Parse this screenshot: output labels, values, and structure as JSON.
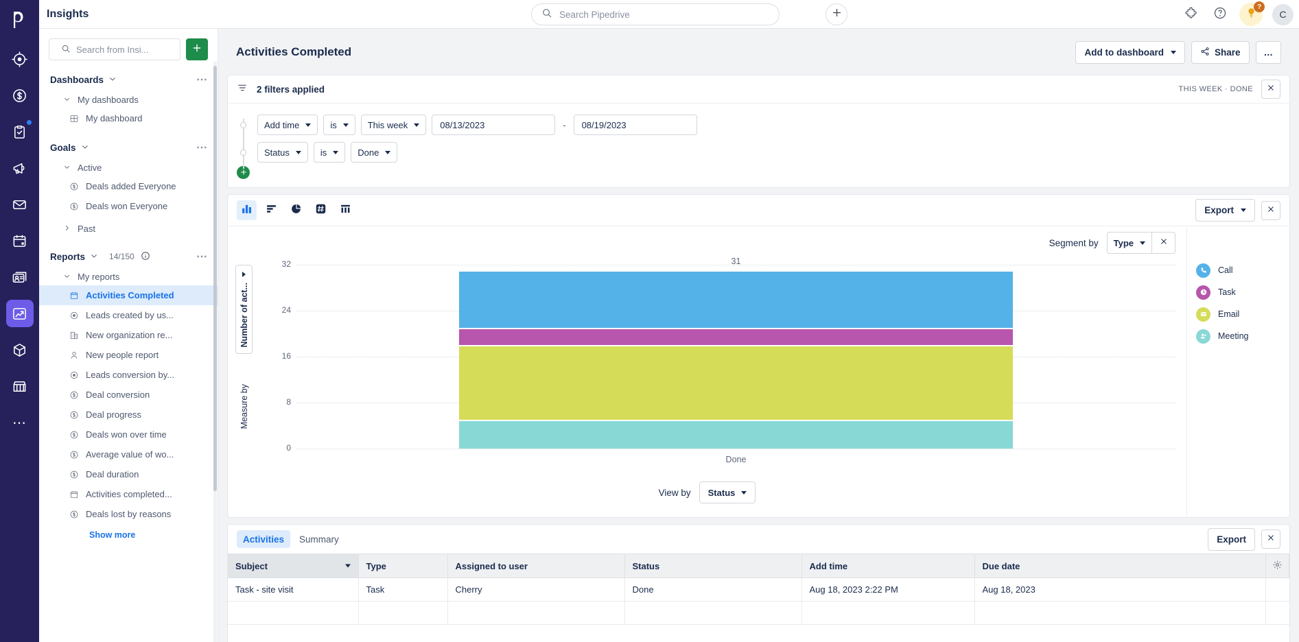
{
  "rail": {
    "logo": "pipedrive-logo",
    "items": [
      {
        "name": "leads-icon",
        "active": false,
        "dot": false
      },
      {
        "name": "deals-icon",
        "active": false,
        "dot": false
      },
      {
        "name": "activities-icon",
        "active": false,
        "dot": true
      },
      {
        "name": "campaigns-icon",
        "active": false,
        "dot": false
      },
      {
        "name": "mail-icon",
        "active": false,
        "dot": false
      },
      {
        "name": "calendar-icon",
        "active": false,
        "dot": false
      },
      {
        "name": "contacts-icon",
        "active": false,
        "dot": false
      },
      {
        "name": "insights-icon",
        "active": true,
        "dot": false
      },
      {
        "name": "products-icon",
        "active": false,
        "dot": false
      },
      {
        "name": "marketplace-icon",
        "active": false,
        "dot": false
      },
      {
        "name": "more-icon",
        "active": false,
        "dot": false
      }
    ]
  },
  "topbar": {
    "title": "Insights",
    "search_placeholder": "Search Pipedrive",
    "add_label": "+",
    "bulb_badge": "?",
    "avatar_initial": "C"
  },
  "sidebar": {
    "search_placeholder": "Search from Insi...",
    "add_label": "+",
    "groups": [
      {
        "title": "Dashboards",
        "sub": "My dashboards",
        "items": [
          {
            "label": "My dashboard",
            "icon": "dashboard-icon",
            "selected": false
          }
        ]
      },
      {
        "title": "Goals",
        "sub": "Active",
        "items": [
          {
            "label": "Deals added Everyone",
            "icon": "deal-icon",
            "selected": false
          },
          {
            "label": "Deals won Everyone",
            "icon": "deal-icon",
            "selected": false
          }
        ],
        "past": "Past"
      },
      {
        "title": "Reports",
        "count": "14/150",
        "sub": "My reports",
        "items": [
          {
            "label": "Activities Completed",
            "icon": "calendar-icon",
            "selected": true
          },
          {
            "label": "Leads created by us...",
            "icon": "leads-icon",
            "selected": false
          },
          {
            "label": "New organization re...",
            "icon": "organization-icon",
            "selected": false
          },
          {
            "label": "New people report",
            "icon": "person-icon",
            "selected": false
          },
          {
            "label": "Leads conversion by...",
            "icon": "leads-icon",
            "selected": false
          },
          {
            "label": "Deal conversion",
            "icon": "deal-icon",
            "selected": false
          },
          {
            "label": "Deal progress",
            "icon": "deal-icon",
            "selected": false
          },
          {
            "label": "Deals won over time",
            "icon": "deal-icon",
            "selected": false
          },
          {
            "label": "Average value of wo...",
            "icon": "deal-icon",
            "selected": false
          },
          {
            "label": "Deal duration",
            "icon": "deal-icon",
            "selected": false
          },
          {
            "label": "Activities completed...",
            "icon": "calendar-icon",
            "selected": false
          },
          {
            "label": "Deals lost by reasons",
            "icon": "deal-icon",
            "selected": false
          }
        ],
        "show_more": "Show more"
      }
    ]
  },
  "report": {
    "title": "Activities Completed",
    "add_to_dashboard": "Add to dashboard",
    "share": "Share",
    "more": "…"
  },
  "filters": {
    "summary": "2 filters applied",
    "tags": "THIS WEEK  ·  DONE",
    "rows": [
      {
        "field": "Add time",
        "operator": "is",
        "value": "This week",
        "date_from": "08/13/2023",
        "date_to": "08/19/2023",
        "separator": "-"
      },
      {
        "field": "Status",
        "operator": "is",
        "value": "Done"
      }
    ]
  },
  "chart_toolbar": {
    "types": [
      {
        "name": "bar-chart-icon",
        "active": true
      },
      {
        "name": "horizontal-bar-chart-icon",
        "active": false
      },
      {
        "name": "pie-chart-icon",
        "active": false
      },
      {
        "name": "scorecard-icon",
        "active": false
      },
      {
        "name": "table-icon",
        "active": false
      }
    ],
    "export": "Export"
  },
  "chart_controls": {
    "segment_by_label": "Segment by",
    "segment_by_value": "Type",
    "view_by_label": "View by",
    "view_by_value": "Status",
    "measure_by_label": "Measure by",
    "y_axis_label": "Number of act..."
  },
  "chart_data": {
    "type": "bar",
    "stacked": true,
    "title": "Activities Completed",
    "xlabel": "",
    "ylabel": "Number of act...",
    "categories": [
      "Done"
    ],
    "ylim": [
      0,
      32
    ],
    "yticks": [
      0,
      8,
      16,
      24,
      32
    ],
    "grid": true,
    "legend_position": "right",
    "data_labels": [
      "31"
    ],
    "totals": [
      31
    ],
    "series": [
      {
        "name": "Call",
        "values": [
          10
        ],
        "color": "#55b2e8"
      },
      {
        "name": "Task",
        "values": [
          3
        ],
        "color": "#b855ac"
      },
      {
        "name": "Email",
        "values": [
          13
        ],
        "color": "#d5dc58"
      },
      {
        "name": "Meeting",
        "values": [
          5
        ],
        "color": "#88d8d6"
      }
    ]
  },
  "legend": [
    {
      "label": "Call",
      "color": "#55b2e8",
      "icon": "phone-icon"
    },
    {
      "label": "Task",
      "color": "#b855ac",
      "icon": "clock-icon"
    },
    {
      "label": "Email",
      "color": "#d5dc58",
      "icon": "envelope-icon"
    },
    {
      "label": "Meeting",
      "color": "#88d8d6",
      "icon": "people-icon"
    }
  ],
  "table": {
    "tabs": [
      {
        "label": "Activities",
        "active": true
      },
      {
        "label": "Summary",
        "active": false
      }
    ],
    "export": "Export",
    "columns": [
      "Subject",
      "Type",
      "Assigned to user",
      "Status",
      "Add time",
      "Due date"
    ],
    "sorted_column": "Subject",
    "rows": [
      {
        "Subject": "Task - site visit",
        "Type": "Task",
        "Assigned to user": "Cherry",
        "Status": "Done",
        "Add time": "Aug 18, 2023 2:22 PM",
        "Due date": "Aug 18, 2023"
      }
    ]
  }
}
